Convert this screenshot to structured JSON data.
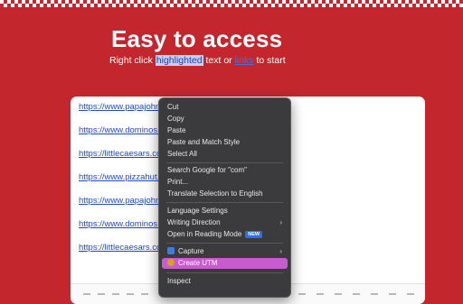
{
  "hero": {
    "title": "Easy to access",
    "subtitle_pre": "Right click ",
    "subtitle_highlight": "highlighted",
    "subtitle_mid": " text or ",
    "subtitle_link": "links",
    "subtitle_post": " to start"
  },
  "links": [
    "https://www.papajohn",
    "https://www.dominos.",
    "https://littlecaesars.co",
    "https://www.pizzahut.",
    "https://www.papajohn",
    "https://www.dominos.",
    "https://littlecaesars.co"
  ],
  "context_menu": {
    "items": [
      {
        "label": "Cut"
      },
      {
        "label": "Copy"
      },
      {
        "label": "Paste"
      },
      {
        "label": "Paste and Match Style"
      },
      {
        "label": "Select All"
      },
      {
        "label": "Search Google for \"com\""
      },
      {
        "label": "Print..."
      },
      {
        "label": "Translate Selection to English"
      },
      {
        "label": "Language Settings"
      },
      {
        "label": "Writing Direction"
      },
      {
        "label": "Open in Reading Mode",
        "badge": "NEW"
      },
      {
        "label": "Capture"
      },
      {
        "label": "Create UTM"
      },
      {
        "label": "Inspect"
      }
    ]
  },
  "colors": {
    "background": "#c4262e",
    "menu_background": "#3b3b3d",
    "menu_highlight": "#c95bd0",
    "link": "#2348c9"
  }
}
